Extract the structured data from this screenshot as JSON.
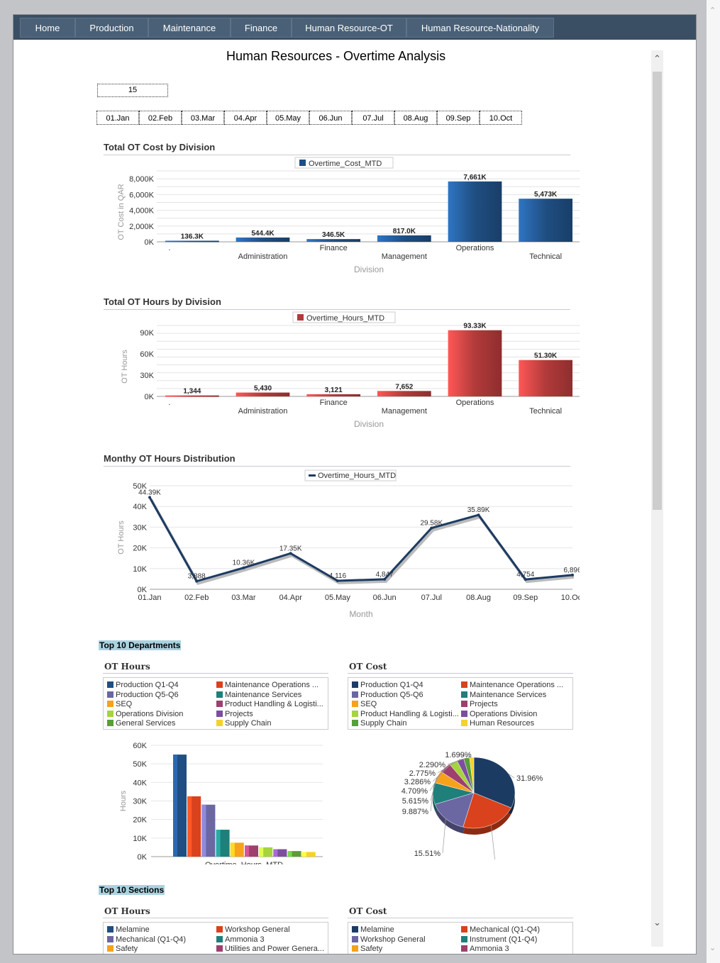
{
  "nav": {
    "tabs": [
      "Home",
      "Production",
      "Maintenance",
      "Finance",
      "Human Resource-OT",
      "Human Resource-Nationality"
    ]
  },
  "page": {
    "title": "Human Resources  - Overtime Analysis"
  },
  "filters": {
    "selected_value": "15",
    "months": [
      "01.Jan",
      "02.Feb",
      "03.Mar",
      "04.Apr",
      "05.May",
      "06.Jun",
      "07.Jul",
      "08.Aug",
      "09.Sep",
      "10.Oct"
    ]
  },
  "chart_data": [
    {
      "type": "bar",
      "title": "Total OT Cost by Division",
      "legend": "Overtime_Cost_MTD",
      "xlabel": "Division",
      "ylabel": "OT Cost in QAR",
      "ylim": [
        0,
        9000000
      ],
      "yticks": [
        "0K",
        "2,000K",
        "4,000K",
        "6,000K",
        "8,000K"
      ],
      "categories": [
        ".",
        "Administration",
        "Finance",
        "Management",
        "Operations",
        "Technical"
      ],
      "values": [
        136300,
        544400,
        346500,
        817000,
        7661000,
        5473000
      ],
      "data_labels": [
        "136.3K",
        "544.4K",
        "346.5K",
        "817.0K",
        "7,661K",
        "5,473K"
      ],
      "color": "#1f4e82"
    },
    {
      "type": "bar",
      "title": "Total OT Hours by Division",
      "legend": "Overtime_Hours_MTD",
      "xlabel": "Division",
      "ylabel": "OT Hours",
      "ylim": [
        0,
        100000
      ],
      "yticks": [
        "0K",
        "30K",
        "60K",
        "90K"
      ],
      "categories": [
        ".",
        "Administration",
        "Finance",
        "Management",
        "Operations",
        "Technical"
      ],
      "values": [
        1344,
        5430,
        3121,
        7652,
        93330,
        51300
      ],
      "data_labels": [
        "1,344",
        "5,430",
        "3,121",
        "7,652",
        "93.33K",
        "51.30K"
      ],
      "color": "#b23a3a"
    },
    {
      "type": "line",
      "title": "Monthy OT Hours Distribution",
      "legend": "Overtime_Hours_MTD",
      "xlabel": "Month",
      "ylabel": "OT Hours",
      "ylim": [
        0,
        50000
      ],
      "yticks": [
        "0K",
        "10K",
        "20K",
        "30K",
        "40K",
        "50K"
      ],
      "categories": [
        "01.Jan",
        "02.Feb",
        "03.Mar",
        "04.Apr",
        "05.May",
        "06.Jun",
        "07.Jul",
        "08.Aug",
        "09.Sep",
        "10.Oct"
      ],
      "values": [
        44390,
        3888,
        10360,
        17350,
        4116,
        4847,
        29580,
        35890,
        4754,
        6896
      ],
      "data_labels": [
        "44.39K",
        "3,888",
        "10.36K",
        "17.35K",
        "4,116",
        "4,847",
        "29.58K",
        "35.89K",
        "4,754",
        "6,896"
      ],
      "color": "#1c3b63"
    },
    {
      "type": "bar",
      "title": "OT Hours",
      "xlabel": "Overtime_Hours_MTD",
      "ylabel": "Hours",
      "ylim": [
        0,
        60000
      ],
      "yticks": [
        "0K",
        "10K",
        "20K",
        "30K",
        "40K",
        "50K",
        "60K"
      ],
      "series_names": [
        "Production Q1-Q4",
        "Maintenance Operations",
        "Production Q5-Q6",
        "Maintenance Services",
        "SEQ",
        "Product Handling & Logisti...",
        "Operations Division",
        "Projects",
        "General Services",
        "Supply Chain"
      ],
      "values": [
        55000,
        32500,
        28000,
        14500,
        7500,
        6000,
        5000,
        4000,
        3000,
        2500
      ],
      "colors": [
        "#1f4e82",
        "#d9421c",
        "#6a67a3",
        "#1f7f7a",
        "#f7a21b",
        "#9e3f6e",
        "#a5d43c",
        "#7b4ea0",
        "#5a9e36",
        "#f5d227"
      ]
    },
    {
      "type": "pie",
      "title": "OT Cost",
      "xlabel": "Overtime_Cost_MTD",
      "slices": [
        {
          "name": "Production Q1-Q4",
          "value": 31.96,
          "label": "31.96%",
          "color": "#1c3b63"
        },
        {
          "name": "Maintenance Operations",
          "value": 22.27,
          "label": "22.27%",
          "color": "#d9421c"
        },
        {
          "name": "Production Q5-Q6",
          "value": 15.51,
          "label": "15.51%",
          "color": "#6a67a3"
        },
        {
          "name": "Maintenance Services",
          "value": 9.887,
          "label": "9.887%",
          "color": "#1f7f7a"
        },
        {
          "name": "SEQ",
          "value": 5.615,
          "label": "5.615%",
          "color": "#f7a21b"
        },
        {
          "name": "Projects",
          "value": 4.709,
          "label": "4.709%",
          "color": "#9e3f6e"
        },
        {
          "name": "Product Handling & Logisti...",
          "value": 3.286,
          "label": "3.286%",
          "color": "#a5d43c"
        },
        {
          "name": "Operations Division",
          "value": 2.775,
          "label": "2.775%",
          "color": "#7b4ea0"
        },
        {
          "name": "Supply Chain",
          "value": 2.29,
          "label": "2.290%",
          "color": "#5a9e36"
        },
        {
          "name": "Human Resources",
          "value": 1.699,
          "label": "1.699%",
          "color": "#f5d227"
        }
      ]
    }
  ],
  "top_departments": {
    "heading": "Top 10 Departments",
    "ot_hours_title": "OT Hours",
    "ot_cost_title": "OT Cost",
    "ot_hours_legend": [
      {
        "label": "Production Q1-Q4",
        "color": "#1f4e82"
      },
      {
        "label": "Maintenance Operations    ...",
        "color": "#d9421c"
      },
      {
        "label": "Production Q5-Q6",
        "color": "#6a67a3"
      },
      {
        "label": "Maintenance Services",
        "color": "#1f7f7a"
      },
      {
        "label": "SEQ",
        "color": "#f7a21b"
      },
      {
        "label": "Product Handling & Logisti...",
        "color": "#9e3f6e"
      },
      {
        "label": "Operations Division",
        "color": "#a5d43c"
      },
      {
        "label": "Projects",
        "color": "#7b4ea0"
      },
      {
        "label": "General Services",
        "color": "#5a9e36"
      },
      {
        "label": "Supply Chain",
        "color": "#f5d227"
      }
    ],
    "ot_cost_legend": [
      {
        "label": "Production Q1-Q4",
        "color": "#1c3b63"
      },
      {
        "label": "Maintenance Operations    ...",
        "color": "#d9421c"
      },
      {
        "label": "Production Q5-Q6",
        "color": "#6a67a3"
      },
      {
        "label": "Maintenance Services",
        "color": "#1f7f7a"
      },
      {
        "label": "SEQ",
        "color": "#f7a21b"
      },
      {
        "label": "Projects",
        "color": "#9e3f6e"
      },
      {
        "label": "Product Handling & Logisti...",
        "color": "#a5d43c"
      },
      {
        "label": "Operations Division",
        "color": "#7b4ea0"
      },
      {
        "label": "Supply Chain",
        "color": "#5a9e36"
      },
      {
        "label": "Human Resources",
        "color": "#f5d227"
      }
    ]
  },
  "top_sections": {
    "heading": "Top 10 Sections",
    "ot_hours_title": "OT Hours",
    "ot_cost_title": "OT Cost",
    "ot_hours_legend": [
      {
        "label": "Melamine",
        "color": "#1f4e82"
      },
      {
        "label": "Workshop General",
        "color": "#d9421c"
      },
      {
        "label": "Mechanical (Q1-Q4)",
        "color": "#6a67a3"
      },
      {
        "label": "Ammonia 3",
        "color": "#1f7f7a"
      },
      {
        "label": "Safety",
        "color": "#f7a21b"
      },
      {
        "label": "Utilities and Power Genera...",
        "color": "#9e3f6e"
      }
    ],
    "ot_cost_legend": [
      {
        "label": "Melamine",
        "color": "#1c3b63"
      },
      {
        "label": "Mechanical (Q1-Q4)",
        "color": "#d9421c"
      },
      {
        "label": "Workshop General",
        "color": "#6a67a3"
      },
      {
        "label": "Instrument (Q1-Q4)",
        "color": "#1f7f7a"
      },
      {
        "label": "Safety",
        "color": "#f7a21b"
      },
      {
        "label": "Ammonia 3",
        "color": "#9e3f6e"
      }
    ]
  }
}
